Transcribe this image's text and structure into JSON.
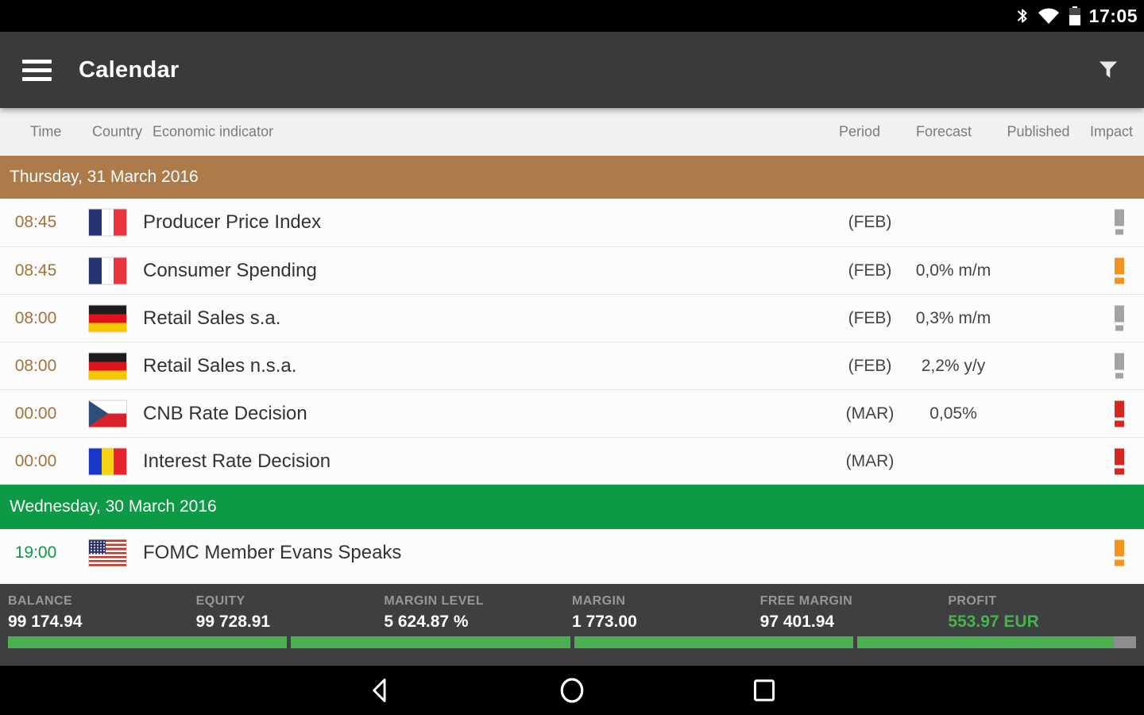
{
  "status_bar": {
    "time": "17:05",
    "icons": [
      "bluetooth-icon",
      "wifi-icon",
      "battery-icon"
    ]
  },
  "app_bar": {
    "title": "Calendar",
    "icons": [
      "menu-icon",
      "filter-icon"
    ]
  },
  "table": {
    "columns": [
      "Time",
      "Country",
      "Economic indicator",
      "Period",
      "Forecast",
      "Published",
      "Impact"
    ]
  },
  "sections": [
    {
      "date_label": "Thursday, 31 March 2016",
      "theme": "brown",
      "events": [
        {
          "time": "08:45",
          "country": "FR",
          "indicator": "Producer Price Index",
          "period": "(FEB)",
          "forecast": "",
          "impact": "gray"
        },
        {
          "time": "08:45",
          "country": "FR",
          "indicator": "Consumer Spending",
          "period": "(FEB)",
          "forecast": "0,0% m/m",
          "impact": "orange"
        },
        {
          "time": "08:00",
          "country": "DE",
          "indicator": "Retail Sales s.a.",
          "period": "(FEB)",
          "forecast": "0,3% m/m",
          "impact": "gray"
        },
        {
          "time": "08:00",
          "country": "DE",
          "indicator": "Retail Sales n.s.a.",
          "period": "(FEB)",
          "forecast": "2,2% y/y",
          "impact": "gray"
        },
        {
          "time": "00:00",
          "country": "CZ",
          "indicator": "CNB Rate Decision",
          "period": "(MAR)",
          "forecast": "0,05%",
          "impact": "red"
        },
        {
          "time": "00:00",
          "country": "RO",
          "indicator": "Interest Rate Decision",
          "period": "(MAR)",
          "forecast": "",
          "impact": "red"
        }
      ]
    },
    {
      "date_label": "Wednesday, 30 March 2016",
      "theme": "green",
      "events": [
        {
          "time": "19:00",
          "country": "US",
          "indicator": "FOMC Member Evans Speaks",
          "period": "",
          "forecast": "",
          "impact": "orange"
        }
      ]
    }
  ],
  "account_bar": {
    "items": [
      {
        "label": "BALANCE",
        "value": "99 174.94",
        "highlight": false
      },
      {
        "label": "EQUITY",
        "value": "99 728.91",
        "highlight": false
      },
      {
        "label": "MARGIN LEVEL",
        "value": "5 624.87 %",
        "highlight": false
      },
      {
        "label": "MARGIN",
        "value": "1 773.00",
        "highlight": false
      },
      {
        "label": "FREE MARGIN",
        "value": "97 401.94",
        "highlight": false
      },
      {
        "label": "PROFIT",
        "value": "553.97 EUR",
        "highlight": true
      }
    ],
    "progress_segments_fill_pct": [
      100,
      100,
      100,
      92
    ]
  },
  "nav_bar": {
    "buttons": [
      "back",
      "home",
      "recents"
    ]
  },
  "colors": {
    "section_brown": "#ad7b4a",
    "section_brown_time": "#a5713a",
    "section_green": "#0c9a45",
    "impact_gray": "#a3a3a3",
    "impact_orange": "#f39422",
    "impact_red": "#d5261f",
    "profit_green": "#4caf50"
  }
}
